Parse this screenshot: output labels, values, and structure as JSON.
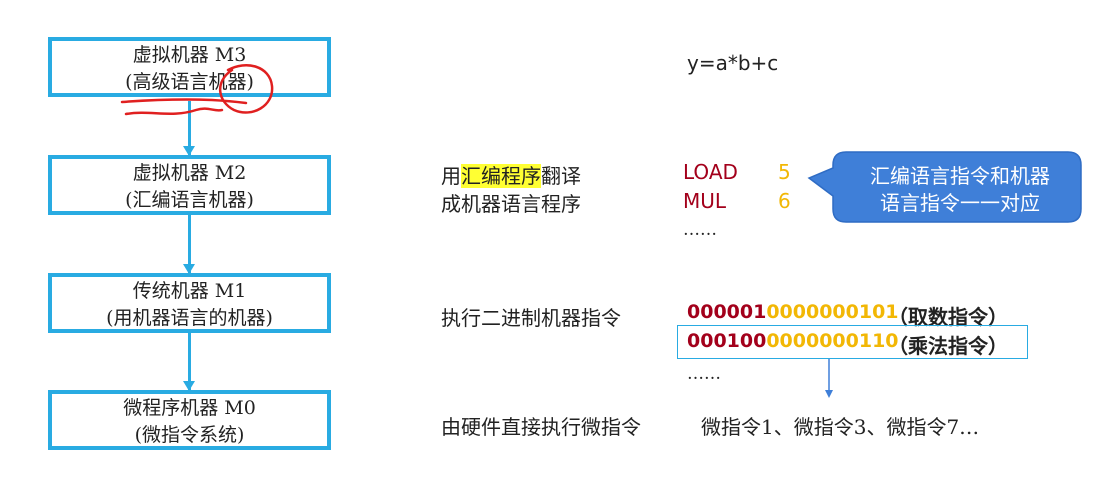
{
  "levels": [
    {
      "name": "虚拟机器 M3",
      "desc_pre": "(",
      "desc_main": "高级语言",
      "desc_post": "机器)"
    },
    {
      "name": "虚拟机器 M2",
      "desc": "(汇编语言机器)"
    },
    {
      "name": "传统机器 M1",
      "desc": "(用机器语言的机器)"
    },
    {
      "name": "微程序机器 M0",
      "desc": "(微指令系统)"
    }
  ],
  "equation": "y=a*b+c",
  "assembly": {
    "line1_pre": "用",
    "line1_highlight": "汇编程序",
    "line1_post": "翻译",
    "line2": "成机器语言程序",
    "instructions": [
      {
        "op": "LOAD",
        "arg": "5"
      },
      {
        "op": "MUL",
        "arg": "6"
      }
    ],
    "ellipsis": "……",
    "callout": [
      "汇编语言指令和机器",
      "语言指令一一对应"
    ]
  },
  "machine": {
    "label": "执行二进制机器指令",
    "rows": [
      {
        "opcode": "000001",
        "operand": "0000000101",
        "note": "（取数指令）"
      },
      {
        "opcode": "000100",
        "operand": "0000000110",
        "note": "（乘法指令）"
      }
    ],
    "ellipsis": "……"
  },
  "micro": {
    "label": "由硬件直接执行微指令",
    "text": "微指令1、微指令3、微指令7…"
  },
  "colors": {
    "accent": "#29abe2",
    "opcode": "#a3001b",
    "operand": "#f2b705",
    "highlight": "#ffff33",
    "callout": "#3f7fd8",
    "pen": "#e02020"
  }
}
